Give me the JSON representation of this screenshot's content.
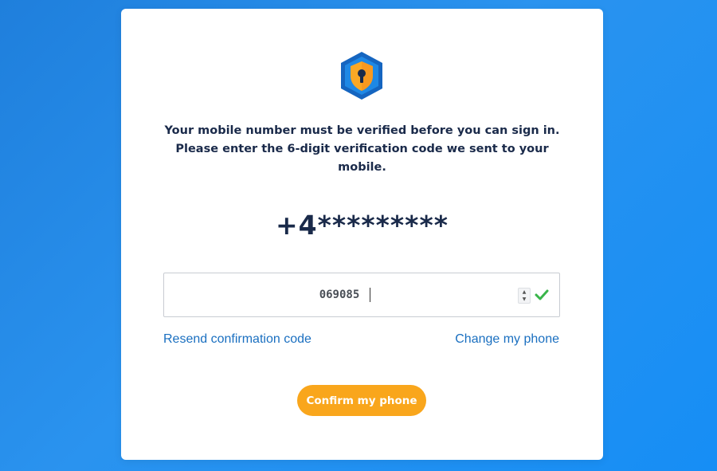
{
  "logo": {
    "icon": "shield-lock-icon",
    "colors": {
      "hex_outer": "#1565c0",
      "hex_inner": "#1e88e5",
      "shield": "#f9a825",
      "keyhole": "#1a2a4a"
    }
  },
  "verification": {
    "message": "Your mobile number must be verified before you can sign in. Please enter the 6-digit verification code we sent to your mobile.",
    "masked_phone": "+4*********"
  },
  "code_input": {
    "value": "069085",
    "valid": true,
    "valid_icon": "checkmark-icon",
    "valid_color": "#39b54a"
  },
  "links": {
    "resend": "Resend confirmation code",
    "change_phone": "Change my phone"
  },
  "actions": {
    "confirm_label": "Confirm my phone"
  },
  "colors": {
    "background": "#2a93ef",
    "card": "#ffffff",
    "accent": "#f9a61c",
    "link": "#1a6fc0",
    "text": "#1a2a4a"
  }
}
